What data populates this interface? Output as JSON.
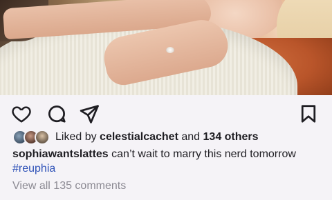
{
  "post": {
    "image_alt": "couple embracing, hand with engagement ring",
    "actions": {
      "like_icon": "heart-icon",
      "comment_icon": "comment-icon",
      "share_icon": "send-icon",
      "save_icon": "bookmark-icon"
    },
    "likes": {
      "prefix": "Liked by",
      "user": "celestialcachet",
      "connector": "and",
      "others": "134 others"
    },
    "caption": {
      "username": "sophiawantslattes",
      "text": "can’t wait to marry this nerd tomorrow",
      "hashtag": "#reuphia"
    },
    "comments_link": "View all 135 comments"
  },
  "colors": {
    "text": "#1e1d22",
    "hashtag": "#2f52b8",
    "muted": "#8c8a93",
    "background": "#f5f3f7"
  }
}
